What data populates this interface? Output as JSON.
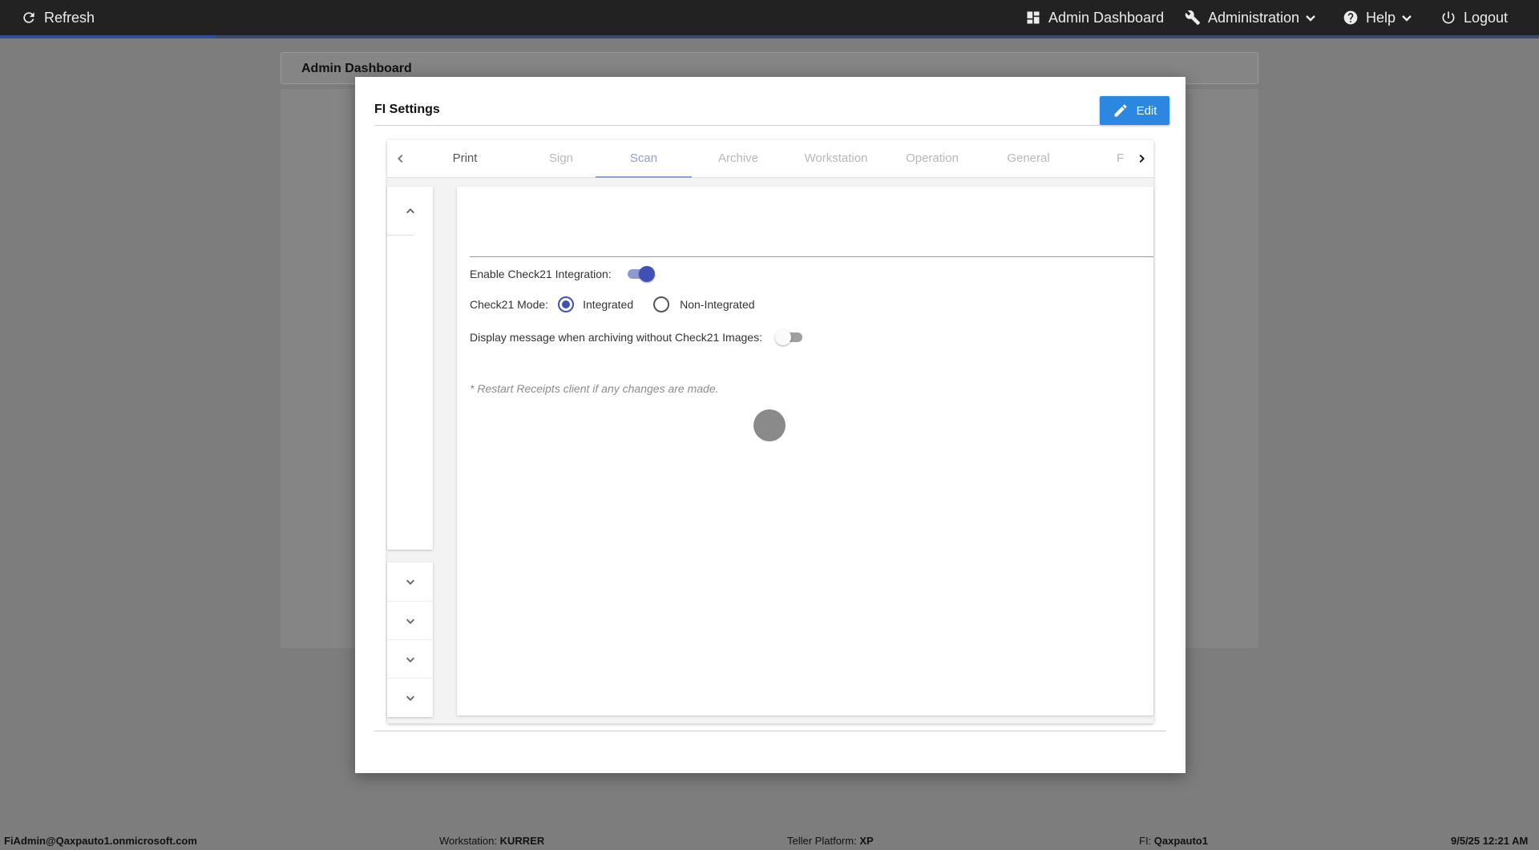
{
  "topnav": {
    "refresh_label": "Refresh",
    "admin_dashboard_label": "Admin Dashboard",
    "administration_label": "Administration",
    "help_label": "Help",
    "logout_label": "Logout",
    "loading_progress_fraction": 0.14
  },
  "background_page": {
    "header_title": "Admin Dashboard"
  },
  "modal": {
    "title": "FI Settings",
    "edit_label": "Edit",
    "tabs": [
      {
        "label": "Print",
        "state": "normal"
      },
      {
        "label": "Sign",
        "state": "disabled"
      },
      {
        "label": "Scan",
        "state": "active"
      },
      {
        "label": "Archive",
        "state": "disabled"
      },
      {
        "label": "Workstation",
        "state": "disabled"
      },
      {
        "label": "Operation",
        "state": "disabled"
      },
      {
        "label": "General",
        "state": "disabled"
      },
      {
        "label": "F",
        "state": "disabled"
      }
    ],
    "settings": {
      "enable_check21_label": "Enable Check21 Integration:",
      "enable_check21_on": true,
      "check21_mode_label": "Check21 Mode:",
      "mode_options": [
        {
          "label": "Integrated",
          "selected": true
        },
        {
          "label": "Non-Integrated",
          "selected": false
        }
      ],
      "display_message_label": "Display message when archiving without Check21 Images:",
      "display_message_on": false,
      "restart_note": "* Restart Receipts client if any changes are made."
    }
  },
  "footer": {
    "user": "FiAdmin@Qaxpauto1.onmicrosoft.com",
    "workstation_label": "Workstation:",
    "workstation_value": "KURRER",
    "teller_platform_label": "Teller Platform:",
    "teller_platform_value": "XP",
    "fi_label": "FI:",
    "fi_value": "Qaxpauto1",
    "datetime": "9/5/25 12:21 AM"
  },
  "colors": {
    "accent": "#3f51b5",
    "edit_button": "#2b87e0",
    "topnav_bg": "#222222"
  }
}
